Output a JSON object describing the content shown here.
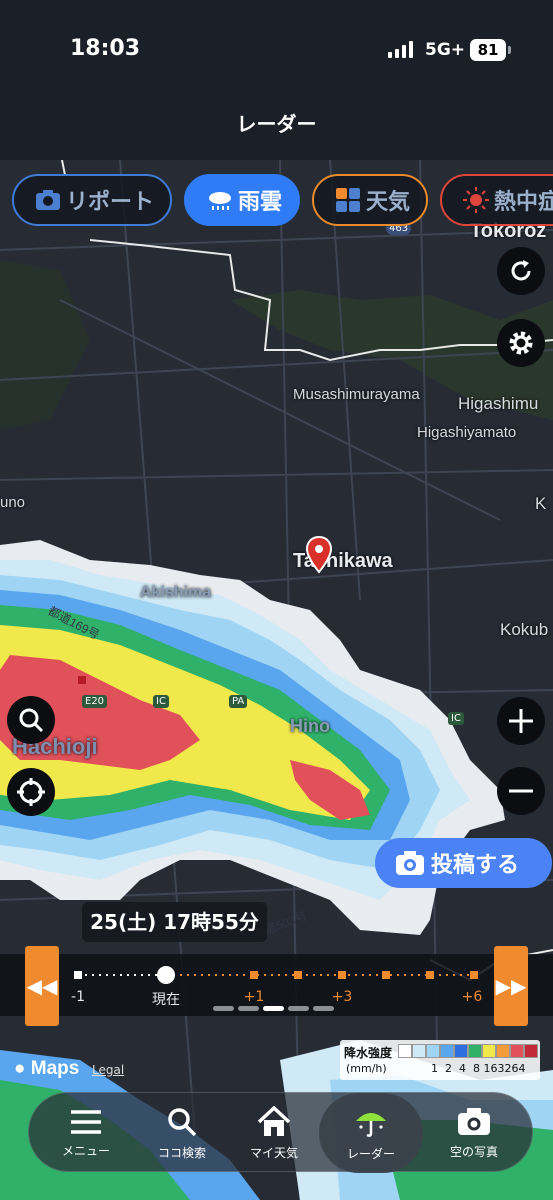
{
  "status_bar": {
    "time": "18:03",
    "network": "5G+",
    "battery": "81"
  },
  "header": {
    "title": "レーダー"
  },
  "layer_chips": [
    {
      "label": "リポート",
      "icon": "camera-icon"
    },
    {
      "label": "雨雲",
      "icon": "rain-cloud-icon",
      "selected": true
    },
    {
      "label": "天気",
      "icon": "weather-grid-icon"
    },
    {
      "label": "熱中症",
      "icon": "sun-icon"
    }
  ],
  "map": {
    "place_labels": {
      "tokorozawa": "Tokoroz",
      "musashimurayama": "Musashimurayama",
      "higashimu": "Higashimu",
      "higashiyamato": "Higashiyamato",
      "uno": "uno",
      "tachikawa": "Tachikawa",
      "akishima": "Akishima",
      "hachioji": "Hachioji",
      "hino": "Hino",
      "kokub": "Kokub",
      "k_edge": "K",
      "route_label": "都道169号",
      "road_label_2": "都道503号"
    },
    "road_shields": {
      "e20": "E20",
      "ic1": "IC",
      "pa": "PA",
      "ic2": "IC",
      "r463": "463"
    },
    "pin_icon": "location-pin-icon"
  },
  "controls": {
    "refresh_icon": "refresh-icon",
    "settings_icon": "gear-icon",
    "search_icon": "search-icon",
    "locate_icon": "crosshair-icon",
    "zoom_in_icon": "plus-icon",
    "zoom_out_icon": "minus-icon",
    "post_label": "投稿する"
  },
  "time_display": "25(土) 17時55分",
  "timeline": {
    "labels": [
      {
        "text": "-1",
        "style": "white"
      },
      {
        "text": "現在",
        "style": "white"
      },
      {
        "text": "+1",
        "style": "orange"
      },
      {
        "text": "+3",
        "style": "orange"
      },
      {
        "text": "+6",
        "style": "orange"
      }
    ],
    "back_label": "◀◀",
    "forward_label": "▶▶",
    "current_position": "現在",
    "pages": 5,
    "active_page": 3
  },
  "legend": {
    "title": "降水強度",
    "unit": "(mm/h)",
    "values": [
      "1",
      "2",
      "4",
      "8",
      "16",
      "32",
      "64"
    ],
    "colors": [
      "#ffffff",
      "#cfe9f7",
      "#9fd4f4",
      "#5aa6ee",
      "#2d6ee0",
      "#2fb16a",
      "#f1e84b",
      "#f39a3a",
      "#e0515a",
      "#c22a3a"
    ]
  },
  "attribution": {
    "maps": "Maps",
    "legal": "Legal"
  },
  "bottom_nav": [
    {
      "label": "メニュー",
      "icon": "menu-icon"
    },
    {
      "label": "ココ検索",
      "icon": "search-icon"
    },
    {
      "label": "マイ天気",
      "icon": "home-icon"
    },
    {
      "label": "レーダー",
      "icon": "umbrella-icon",
      "active": true
    },
    {
      "label": "空の写真",
      "icon": "camera-icon"
    }
  ]
}
